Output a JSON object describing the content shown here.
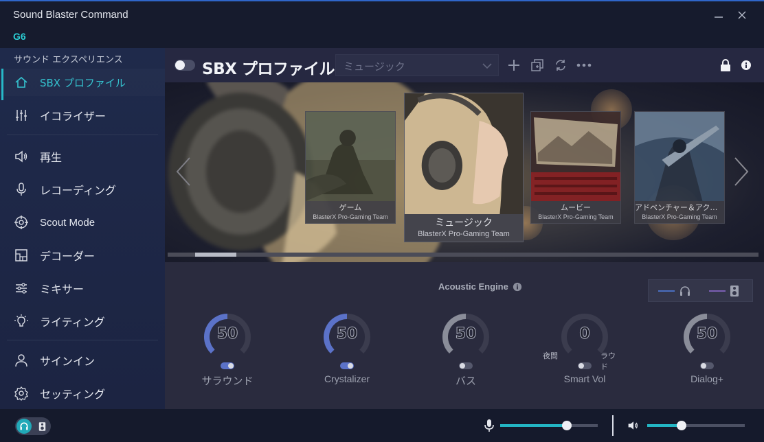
{
  "window": {
    "title": "Sound Blaster Command",
    "device": "G6",
    "minimize_icon": "minimize-icon",
    "close_icon": "close-icon"
  },
  "sidebar": {
    "section_label": "サウンド エクスペリエンス",
    "items": [
      {
        "label": "SBX プロファイル",
        "icon": "home-icon",
        "active": true
      },
      {
        "label": "イコライザー",
        "icon": "equalizer-icon"
      },
      {
        "label": "再生",
        "icon": "speaker-icon"
      },
      {
        "label": "レコーディング",
        "icon": "microphone-icon"
      },
      {
        "label": "Scout Mode",
        "icon": "crosshair-icon"
      },
      {
        "label": "デコーダー",
        "icon": "decoder-icon"
      },
      {
        "label": "ミキサー",
        "icon": "mixer-icon"
      },
      {
        "label": "ライティング",
        "icon": "bulb-icon"
      },
      {
        "label": "サインイン",
        "icon": "user-icon"
      },
      {
        "label": "セッティング",
        "icon": "gear-icon"
      }
    ]
  },
  "toolbar": {
    "enabled": false,
    "title": "SBX プロファイル",
    "profile_select": "ミュージック"
  },
  "carousel": {
    "cards": [
      {
        "name": "ゲーム",
        "team": "BlasterX Pro-Gaming Team"
      },
      {
        "name": "ミュージック",
        "team": "BlasterX Pro-Gaming Team",
        "selected": true
      },
      {
        "name": "ムービー",
        "team": "BlasterX Pro-Gaming Team"
      },
      {
        "name": "アドベンチャー＆アクション",
        "team": "BlasterX Pro-Gaming Team"
      }
    ]
  },
  "controls": {
    "title": "Acoustic Engine",
    "knobs": [
      {
        "label": "サラウンド",
        "value": "50",
        "level": 50,
        "enabled": true
      },
      {
        "label": "Crystalizer",
        "value": "50",
        "level": 50,
        "enabled": true
      },
      {
        "label": "バス",
        "value": "50",
        "level": 50,
        "enabled": false
      },
      {
        "label": "Smart Vol",
        "value": "0",
        "level": 0,
        "enabled": false,
        "left_label": "夜間",
        "right_label": "ラウド"
      },
      {
        "label": "Dialog+",
        "value": "50",
        "level": 50,
        "enabled": false
      }
    ]
  },
  "footer": {
    "output_mode": "headphones",
    "mic_volume_percent": 68,
    "speaker_volume_percent": 35
  },
  "colors": {
    "accent": "#27b8c8",
    "knob_active": "#5b72c8",
    "knob_inactive": "#8a8d99"
  }
}
